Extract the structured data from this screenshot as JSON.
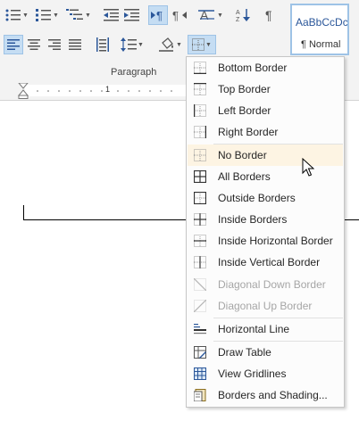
{
  "ribbon": {
    "group_label": "Paragraph",
    "style_gallery": {
      "preview_text": "AaBbCcDc",
      "style_name": "¶ Normal"
    },
    "accent_color": "#2b579a",
    "active_color": "#c5ddf3"
  },
  "ruler": {
    "marker": "1"
  },
  "borders_menu": {
    "items": [
      {
        "label": "Bottom Border",
        "icon": "border-bottom-icon",
        "enabled": true
      },
      {
        "label": "Top Border",
        "icon": "border-top-icon",
        "enabled": true
      },
      {
        "label": "Left Border",
        "icon": "border-left-icon",
        "enabled": true
      },
      {
        "label": "Right Border",
        "icon": "border-right-icon",
        "enabled": true
      },
      {
        "label": "No Border",
        "icon": "no-border-icon",
        "enabled": true,
        "hovered": true
      },
      {
        "label": "All Borders",
        "icon": "all-borders-icon",
        "enabled": true
      },
      {
        "label": "Outside Borders",
        "icon": "outside-borders-icon",
        "enabled": true
      },
      {
        "label": "Inside Borders",
        "icon": "inside-borders-icon",
        "enabled": true
      },
      {
        "label": "Inside Horizontal Border",
        "icon": "inside-horizontal-border-icon",
        "enabled": true
      },
      {
        "label": "Inside Vertical Border",
        "icon": "inside-vertical-border-icon",
        "enabled": true
      },
      {
        "label": "Diagonal Down Border",
        "icon": "diagonal-down-border-icon",
        "enabled": false
      },
      {
        "label": "Diagonal Up Border",
        "icon": "diagonal-up-border-icon",
        "enabled": false
      },
      {
        "label": "Horizontal Line",
        "icon": "horizontal-line-icon",
        "enabled": true
      },
      {
        "label": "Draw Table",
        "icon": "draw-table-icon",
        "enabled": true
      },
      {
        "label": "View Gridlines",
        "icon": "view-gridlines-icon",
        "enabled": true
      },
      {
        "label": "Borders and Shading...",
        "icon": "borders-and-shading-icon",
        "enabled": true
      }
    ]
  }
}
